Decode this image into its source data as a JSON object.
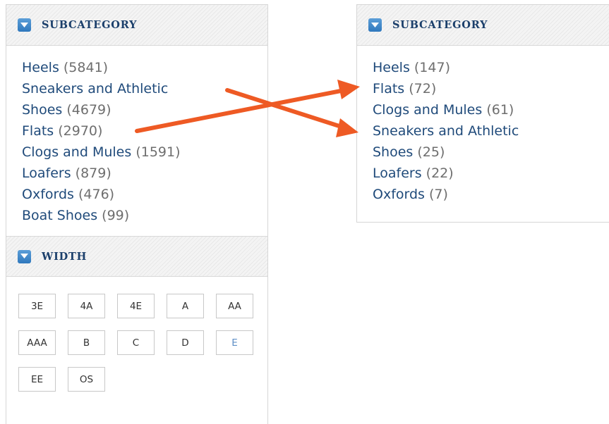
{
  "accent_color": "#ee5a24",
  "left_panel": {
    "subcategory": {
      "title": "SUBCATEGORY",
      "items": [
        {
          "label": "Heels",
          "count": "(5841)"
        },
        {
          "label": "Sneakers and Athletic",
          "label2": "Shoes",
          "count": "(4679)"
        },
        {
          "label": "Flats",
          "count": "(2970)"
        },
        {
          "label": "Clogs and Mules",
          "count": "(1591)"
        },
        {
          "label": "Loafers",
          "count": "(879)"
        },
        {
          "label": "Oxfords",
          "count": "(476)"
        },
        {
          "label": "Boat Shoes",
          "count": "(99)"
        }
      ]
    },
    "width": {
      "title": "WIDTH",
      "options": [
        "3E",
        "4A",
        "4E",
        "A",
        "AA",
        "AAA",
        "B",
        "C",
        "D",
        "E",
        "EE",
        "OS"
      ]
    }
  },
  "right_panel": {
    "subcategory": {
      "title": "SUBCATEGORY",
      "items": [
        {
          "label": "Heels",
          "count": "(147)"
        },
        {
          "label": "Flats",
          "count": "(72)"
        },
        {
          "label": "Clogs and Mules",
          "count": "(61)"
        },
        {
          "label": "Sneakers and Athletic",
          "label2": "Shoes",
          "count": "(25)"
        },
        {
          "label": "Loafers",
          "count": "(22)"
        },
        {
          "label": "Oxfords",
          "count": "(7)"
        }
      ]
    }
  }
}
